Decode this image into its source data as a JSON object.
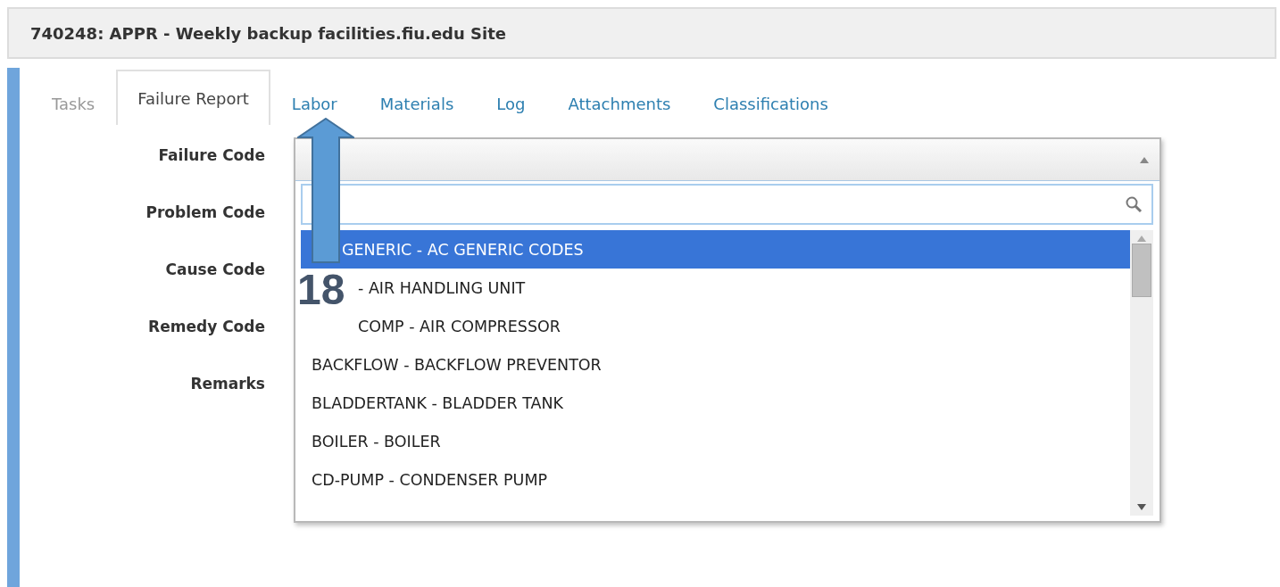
{
  "header": {
    "title": "740248: APPR - Weekly backup facilities.fiu.edu Site"
  },
  "tabs": [
    {
      "label": "Tasks",
      "selected": false,
      "disabled": true
    },
    {
      "label": "Failure Report",
      "selected": true,
      "disabled": false
    },
    {
      "label": "Labor",
      "selected": false,
      "disabled": false
    },
    {
      "label": "Materials",
      "selected": false,
      "disabled": false
    },
    {
      "label": "Log",
      "selected": false,
      "disabled": false
    },
    {
      "label": "Attachments",
      "selected": false,
      "disabled": false
    },
    {
      "label": "Classifications",
      "selected": false,
      "disabled": false
    }
  ],
  "form": {
    "labels": [
      "Failure Code",
      "Problem Code",
      "Cause Code",
      "Remedy Code",
      "Remarks"
    ]
  },
  "dropdown": {
    "expanded": true,
    "items": [
      {
        "text": "GENERIC - AC GENERIC CODES",
        "selected": true,
        "kind": "covered"
      },
      {
        "text": "- AIR HANDLING UNIT",
        "selected": false,
        "kind": "covered"
      },
      {
        "text": "COMP - AIR COMPRESSOR",
        "selected": false,
        "kind": "covered"
      },
      {
        "text": "BACKFLOW - BACKFLOW PREVENTOR",
        "selected": false,
        "kind": "full"
      },
      {
        "text": "BLADDERTANK - BLADDER TANK",
        "selected": false,
        "kind": "full"
      },
      {
        "text": "BOILER - BOILER",
        "selected": false,
        "kind": "full"
      },
      {
        "text": "CD-PUMP - CONDENSER PUMP",
        "selected": false,
        "kind": "full"
      }
    ]
  },
  "annotation": {
    "number": "18"
  }
}
